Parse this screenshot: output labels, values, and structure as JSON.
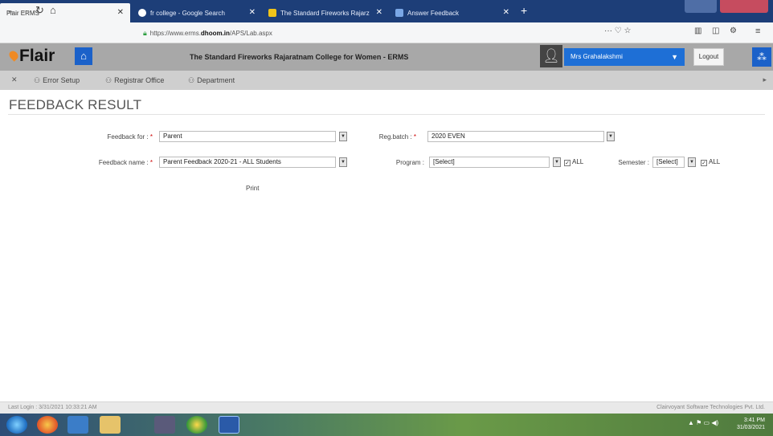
{
  "browser": {
    "tabs": [
      {
        "title": "Flair ERMS",
        "active": true
      },
      {
        "title": "fr college - Google Search",
        "active": false
      },
      {
        "title": "The Standard Fireworks Rajarz",
        "active": false
      },
      {
        "title": "Answer Feedback",
        "active": false
      }
    ],
    "url_prefix": "https://www.erms.",
    "url_domain": "dhoom.in",
    "url_suffix": "/APS/Lab.aspx",
    "page_actions": "··· ♡ ☆"
  },
  "header": {
    "logo": "Flair",
    "college": "The Standard Fireworks Rajaratnam College for Women - ERMS",
    "user": "Mrs Grahalakshmi",
    "logout": "Logout"
  },
  "menu": {
    "items": [
      "Error Setup",
      "Registrar Office",
      "Department"
    ]
  },
  "page": {
    "title": "FEEDBACK RESULT"
  },
  "form": {
    "feedback_for_label": "Feedback for :",
    "feedback_for_value": "Parent",
    "feedback_name_label": "Feedback name :",
    "feedback_name_value": "Parent Feedback 2020-21 - ALL Students",
    "reg_batch_label": "Reg.batch :",
    "reg_batch_value": "2020 EVEN",
    "program_label": "Program :",
    "program_value": "[Select]",
    "program_all": "ALL",
    "semester_label": "Semester :",
    "semester_value": "[Select]",
    "semester_all": "ALL",
    "print": "Print"
  },
  "footer": {
    "last_login": "Last Login : 3/31/2021 10:33:21 AM",
    "company": "Clairvoyant Software Technologies Pvt. Ltd."
  },
  "taskbar": {
    "time": "3:41 PM",
    "date": "31/03/2021"
  }
}
